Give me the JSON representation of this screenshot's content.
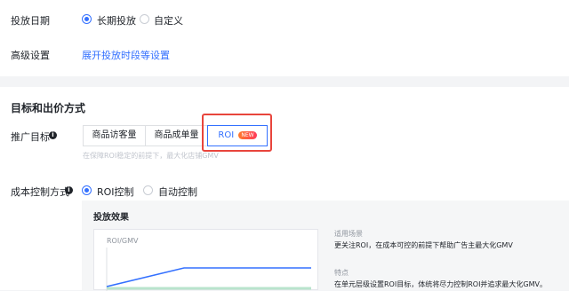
{
  "schedule": {
    "label": "投放日期",
    "options": [
      "长期投放",
      "自定义"
    ],
    "selected": "长期投放"
  },
  "advanced": {
    "label": "高级设置",
    "link": "展开投放时段等设置"
  },
  "goal_section": {
    "title": "目标和出价方式",
    "promo_label": "推广目标",
    "segments": [
      "商品访客量",
      "商品成单量",
      "ROI"
    ],
    "selected": "ROI",
    "new_badge": "NEW",
    "hint": "在保障ROI稳定的前提下，最大化店铺GMV"
  },
  "cost_control": {
    "label": "成本控制方式",
    "options": [
      "ROI控制",
      "自动控制"
    ],
    "selected": "ROI控制"
  },
  "effect": {
    "title": "投放效果",
    "chart_ylabel": "ROI/GMV",
    "scenario_label": "适用场景",
    "scenario_text": "更关注ROI，在成本可控的前提下帮助广告主最大化GMV",
    "feature_label": "特点",
    "feature_text": "在单元层级设置ROI目标，体统将尽力控制ROI并追求最大化GMV。"
  },
  "colors": {
    "accent": "#3370ff",
    "highlight": "#e8453c",
    "badge": "#ff5a2a"
  }
}
